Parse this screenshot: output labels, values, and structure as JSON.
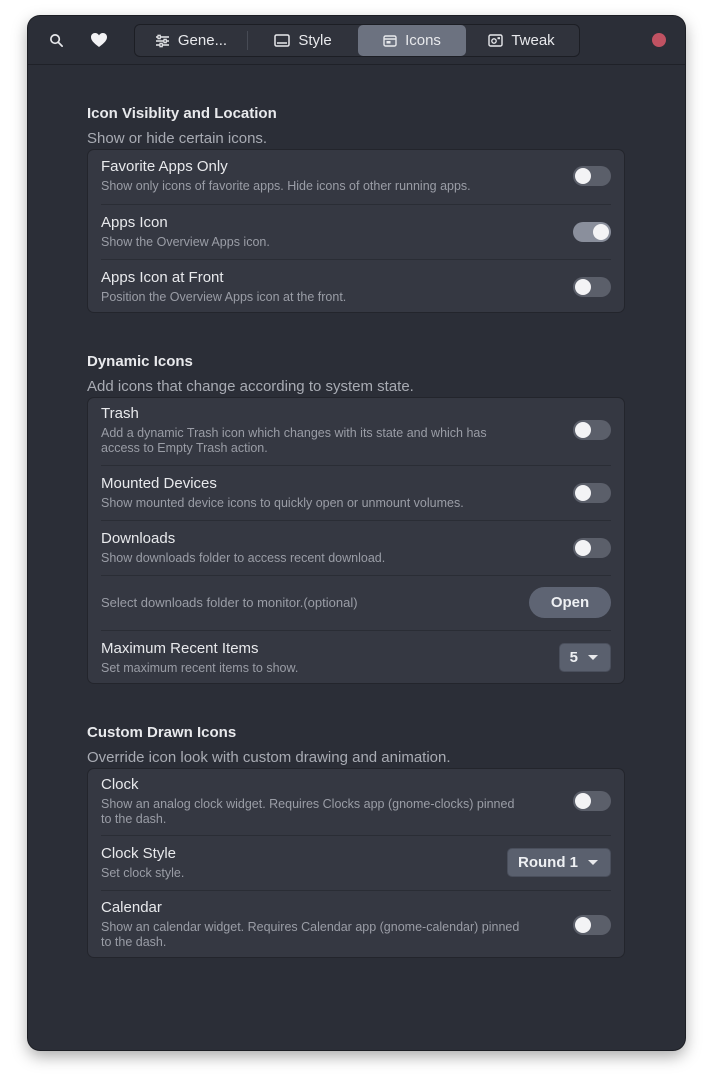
{
  "header": {
    "tabs": [
      {
        "label": "Gene...",
        "icon": "sliders-icon"
      },
      {
        "label": "Style",
        "icon": "display-icon"
      },
      {
        "label": "Icons",
        "icon": "window-icon",
        "active": true
      },
      {
        "label": "Tweak",
        "icon": "tweak-icon"
      }
    ],
    "close_color": "#c05262"
  },
  "sections": [
    {
      "title": "Icon Visiblity and Location",
      "subtitle": "Show or hide certain icons.",
      "rows": [
        {
          "title": "Favorite Apps Only",
          "subtitle": "Show only icons of favorite apps. Hide icons of other running apps.",
          "on": false
        },
        {
          "title": "Apps Icon",
          "subtitle": "Show the Overview Apps icon.",
          "on": true
        },
        {
          "title": "Apps Icon at Front",
          "subtitle": "Position the Overview Apps icon at the front.",
          "on": false
        }
      ]
    },
    {
      "title": "Dynamic Icons",
      "subtitle": "Add icons that change according to system state.",
      "rows": [
        {
          "title": "Trash",
          "subtitle_line1": "Add a dynamic Trash icon which changes with its state and which has",
          "subtitle_line2": "access to Empty Trash action.",
          "on": false
        },
        {
          "title": "Mounted Devices",
          "subtitle": "Show mounted device icons to quickly open or unmount volumes.",
          "on": false
        },
        {
          "title": "Downloads",
          "subtitle": "Show downloads folder to access recent download.",
          "on": false
        },
        {
          "subtitle": "Select downloads folder to monitor.(optional)",
          "button": "Open"
        },
        {
          "title": "Maximum Recent Items",
          "subtitle": "Set maximum recent items to show.",
          "value": "5"
        }
      ]
    },
    {
      "title": "Custom Drawn Icons",
      "subtitle": "Override icon look with custom drawing and animation.",
      "rows": [
        {
          "title": "Clock",
          "subtitle_line1": "Show an analog clock widget. Requires Clocks app (gnome-clocks) pinned",
          "subtitle_line2": "to the dash.",
          "on": false
        },
        {
          "title": "Clock Style",
          "subtitle": "Set clock style.",
          "value": "Round 1"
        },
        {
          "title": "Calendar",
          "subtitle_line1": "Show an calendar widget. Requires Calendar app (gnome-calendar) pinned",
          "subtitle_line2": "to the dash.",
          "on": false
        }
      ]
    }
  ]
}
